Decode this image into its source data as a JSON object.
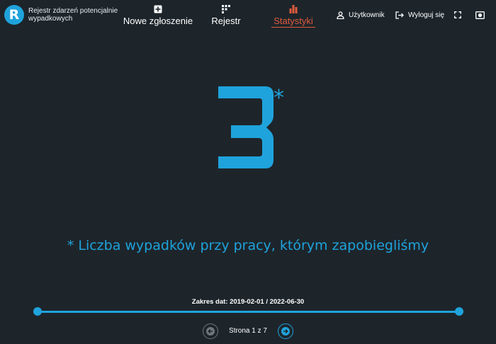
{
  "header": {
    "logo_letter": "R",
    "app_title": "Rejestr zdarzeń potencjalnie wypadkowych",
    "nav": [
      {
        "label": "Nowe zgłoszenie",
        "icon": "plus-square-icon"
      },
      {
        "label": "Rejestr",
        "icon": "grid-icon"
      },
      {
        "label": "Statystyki",
        "icon": "bar-chart-icon",
        "active": true
      }
    ],
    "user_label": "Użytkownik",
    "logout_label": "Wyloguj się"
  },
  "main": {
    "big_number": "3",
    "asterisk": "*",
    "caption": "* Liczba wypadków przy pracy, którym zapobiegliśmy",
    "date_range": "Zakres dat: 2019-02-01 / 2022-06-30",
    "page_label": "Strona 1 z 7"
  },
  "colors": {
    "background": "#1d252b",
    "accent": "#1fa3dc",
    "active_nav": "#e05a3c"
  }
}
